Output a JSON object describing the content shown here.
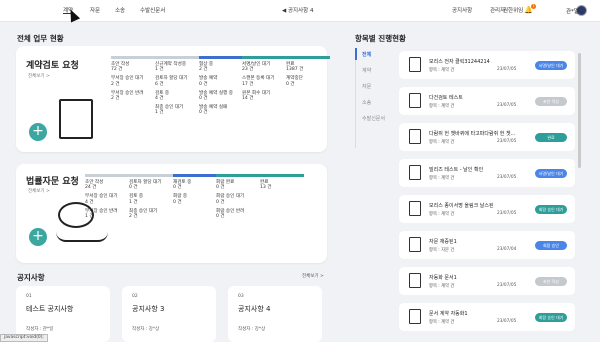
{
  "nav": {
    "items": [
      "계약",
      "자문",
      "소송",
      "수발신문서"
    ],
    "center": "공지사항 4",
    "right": [
      "공지사항",
      "관리자",
      "권한위임"
    ],
    "badge": "1",
    "user": "관*일"
  },
  "main": {
    "title": "전체 업무 현황",
    "notice_title": "공지사항",
    "notice_more": "전체보기 >"
  },
  "contract": {
    "title": "계약검토 요청",
    "more": "전체보기 >",
    "columns": [
      {
        "color": "#c9cfd6",
        "items": [
          {
            "l": "초안 작성",
            "v": "72 건"
          },
          {
            "l": "부서장 승인 대기",
            "v": "2 건"
          },
          {
            "l": "부서장 승인 반려",
            "v": "2 건"
          }
        ]
      },
      {
        "color": "#c9cfd6",
        "items": [
          {
            "l": "신규계약 작성중",
            "v": "1 건"
          },
          {
            "l": "검토자 할당 대기",
            "v": "6 건"
          },
          {
            "l": "검토 중",
            "v": "4 건"
          },
          {
            "l": "최종 승인 대기",
            "v": "1 건"
          }
        ]
      },
      {
        "color": "#3c6fd1",
        "items": [
          {
            "l": "협상 중",
            "v": "2 건"
          },
          {
            "l": "발송 예약",
            "v": "0 건"
          },
          {
            "l": "발송 예약 실행 중",
            "v": "0 건"
          },
          {
            "l": "발송 예약 실패",
            "v": "0 건"
          }
        ]
      },
      {
        "color": "#2d9e9a",
        "items": [
          {
            "l": "서명/날인 대기",
            "v": "23 건"
          },
          {
            "l": "스캔본 등록 대기",
            "v": "17 건"
          },
          {
            "l": "원본 회수 대기",
            "v": "14 건"
          }
        ]
      },
      {
        "color": "#2d9e9a",
        "items": [
          {
            "l": "완료",
            "v": "1387 건"
          },
          {
            "l": "계약중단",
            "v": "0 건"
          }
        ]
      }
    ]
  },
  "legal": {
    "title": "법률자문 요청",
    "more": "전체보기 >",
    "columns": [
      {
        "color": "#c9cfd6",
        "items": [
          {
            "l": "초안 작성",
            "v": "24 건"
          },
          {
            "l": "부서장 승인 대기",
            "v": "4 건"
          },
          {
            "l": "부서장 승인 반려",
            "v": "1 건"
          }
        ]
      },
      {
        "color": "#c9cfd6",
        "items": [
          {
            "l": "검토자 할당 대기",
            "v": "0 건"
          },
          {
            "l": "검토 중",
            "v": "1 건"
          },
          {
            "l": "최종 승인 대기",
            "v": "2 건"
          }
        ]
      },
      {
        "color": "#3c6fd1",
        "items": [
          {
            "l": "재검토 중",
            "v": "0 건"
          },
          {
            "l": "회람 중",
            "v": "0 건"
          }
        ]
      },
      {
        "color": "#2d9e9a",
        "items": [
          {
            "l": "회람 완료",
            "v": "0 건"
          },
          {
            "l": "회람 승인 대기",
            "v": "0 건"
          },
          {
            "l": "회람 승인 반려",
            "v": "0 건"
          }
        ]
      },
      {
        "color": "#2d9e9a",
        "items": [
          {
            "l": "완료",
            "v": "13 건"
          }
        ]
      }
    ]
  },
  "progress": {
    "title": "항목별 진행현황",
    "tabs": [
      "전체",
      "계약",
      "자문",
      "소송",
      "수발신문서"
    ],
    "rows": [
      {
        "t": "모리스 전자 클릭31244214",
        "s": "항목 : 계약 건",
        "d": "23/07/05",
        "b": "서명/날인 대기",
        "c": "#4a86e8"
      },
      {
        "t": "다건검토 테스트",
        "s": "항목 : 계약 건",
        "d": "23/07/05",
        "b": "초안 작성",
        "c": "#c5c8cd"
      },
      {
        "t": "다람쥐 헌 쳇바퀴에 타고파다람쥐 헌 쳇...",
        "s": "항목 : 계약 건",
        "d": "23/07/05",
        "b": "완료",
        "c": "#2d9e9a"
      },
      {
        "t": "빌리즈 테스트 - 날인 확인",
        "s": "항목 : 계약 건",
        "d": "23/07/05",
        "b": "서명/날인 대기",
        "c": "#4a86e8"
      },
      {
        "t": "모리스 종이서명 올림크 날스된",
        "s": "항목 : 계약 건",
        "d": "23/07/05",
        "b": "회람 승인 대기",
        "c": "#2d9e9a"
      },
      {
        "t": "자문 재증된1",
        "s": "항목 : 자문 건",
        "d": "23/07/04",
        "b": "회람 승인",
        "c": "#4a86e8"
      },
      {
        "t": "자동화 문서1",
        "s": "항목 : 계약 건",
        "d": "23/07/05",
        "b": "초안 작성",
        "c": "#c5c8cd"
      },
      {
        "t": "문서 계약 자동화1",
        "s": "항목 : 계약 건",
        "d": "23/07/05",
        "b": "회람 승인 대기",
        "c": "#2d9e9a"
      }
    ]
  },
  "notices": [
    {
      "num": "01",
      "title": "테스트 공지사항",
      "author": "작성자 : 관*일"
    },
    {
      "num": "02",
      "title": "공지사항 3",
      "author": "작성자 : 강*상"
    },
    {
      "num": "03",
      "title": "공지사항 4",
      "author": "작성자 : 강*상"
    }
  ],
  "statusbar": "javascript:void(0);"
}
